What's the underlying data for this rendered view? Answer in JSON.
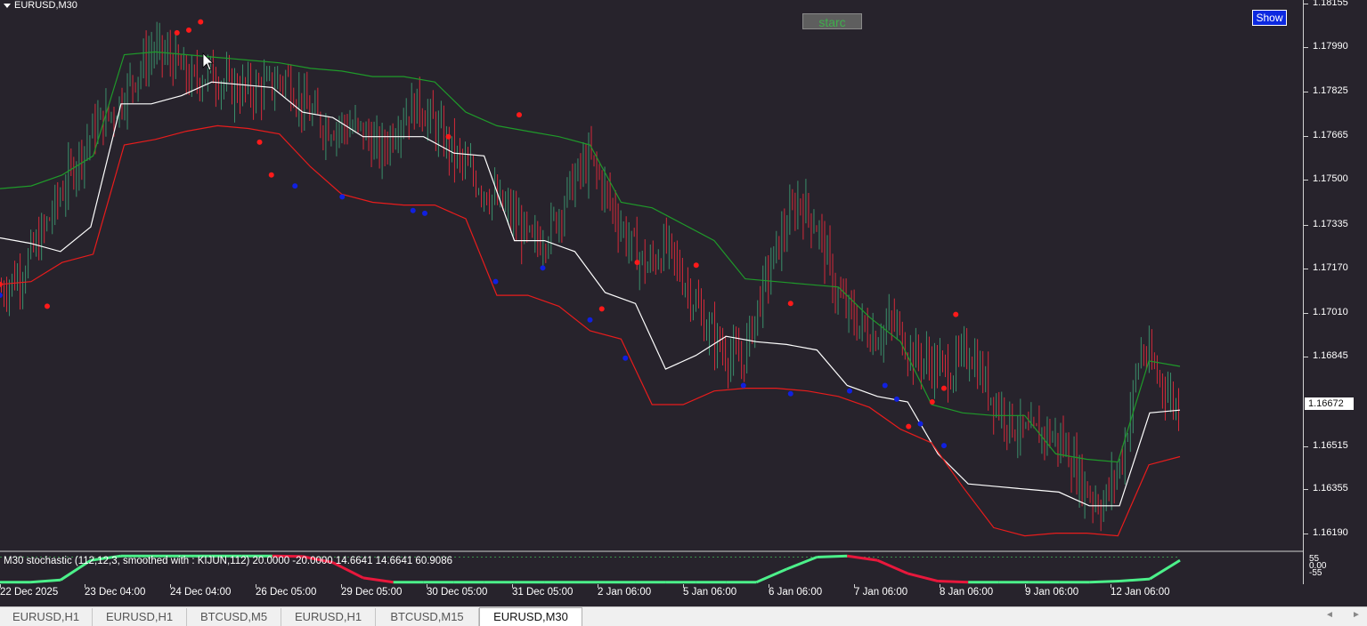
{
  "window": {
    "symbol_title": "EURUSD,M30"
  },
  "buttons": {
    "starc": "starc",
    "show": "Show"
  },
  "indicator": {
    "label": "M30 stochastic (112,12,3, smoothed with : KIJUN,112) 20.0000 -20.0000 14.6641 14.6641 60.9086"
  },
  "price_axis": {
    "labels": [
      "1.18155",
      "1.17990",
      "1.17825",
      "1.17665",
      "1.17500",
      "1.17335",
      "1.17170",
      "1.17010",
      "1.16845",
      "1.16515",
      "1.16355",
      "1.16190"
    ],
    "current_price": "1.16672"
  },
  "sub_axis": {
    "labels": [
      "55",
      "0.00",
      "-55"
    ]
  },
  "time_axis": {
    "labels": [
      "22 Dec 2025",
      "23 Dec 04:00",
      "24 Dec 04:00",
      "26 Dec 05:00",
      "29 Dec 05:00",
      "30 Dec 05:00",
      "31 Dec 05:00",
      "2 Jan 06:00",
      "5 Jan 06:00",
      "6 Jan 06:00",
      "7 Jan 06:00",
      "8 Jan 06:00",
      "9 Jan 06:00",
      "12 Jan 06:00"
    ]
  },
  "tabs": [
    {
      "label": "EURUSD,H1",
      "active": false
    },
    {
      "label": "EURUSD,H1",
      "active": false
    },
    {
      "label": "BTCUSD,M5",
      "active": false
    },
    {
      "label": "EURUSD,H1",
      "active": false
    },
    {
      "label": "BTCUSD,M15",
      "active": false
    },
    {
      "label": "EURUSD,M30",
      "active": true
    }
  ],
  "colors": {
    "background": "#27232c",
    "bull_candle": "#3a8f6b",
    "bear_candle": "#d42a3a",
    "upper_band": "#1f9a2a",
    "middle_line": "#ffffff",
    "lower_band": "#e81c1c",
    "signal_up": "#ff1a1a",
    "signal_down": "#1020e0",
    "stochastic_up": "#4cf08a",
    "stochastic_down": "#e8183c"
  },
  "chart_data": {
    "type": "line",
    "symbol": "EURUSD",
    "timeframe": "M30",
    "ylim": [
      1.1617,
      1.1818
    ],
    "x_ticks": [
      "22 Dec 2025",
      "23 Dec 04:00",
      "24 Dec 04:00",
      "26 Dec 05:00",
      "29 Dec 05:00",
      "30 Dec 05:00",
      "31 Dec 05:00",
      "2 Jan 06:00",
      "5 Jan 06:00",
      "6 Jan 06:00",
      "7 Jan 06:00",
      "8 Jan 06:00",
      "9 Jan 06:00",
      "12 Jan 06:00"
    ],
    "price_path": [
      1.1712,
      1.1718,
      1.173,
      1.1745,
      1.176,
      1.1772,
      1.1778,
      1.179,
      1.18,
      1.1796,
      1.1788,
      1.1792,
      1.1786,
      1.1785,
      1.1786,
      1.179,
      1.1778,
      1.1772,
      1.1772,
      1.177,
      1.1762,
      1.1775,
      1.178,
      1.177,
      1.176,
      1.1752,
      1.1745,
      1.1738,
      1.1728,
      1.1735,
      1.175,
      1.176,
      1.1745,
      1.173,
      1.172,
      1.1728,
      1.1715,
      1.17,
      1.169,
      1.1685,
      1.171,
      1.173,
      1.1745,
      1.1735,
      1.171,
      1.17,
      1.1695,
      1.17,
      1.1688,
      1.1685,
      1.1682,
      1.169,
      1.1675,
      1.1665,
      1.1658,
      1.166,
      1.1655,
      1.164,
      1.1633,
      1.165,
      1.169,
      1.168,
      1.1668
    ],
    "middle_line": [
      1.1731,
      1.1729,
      1.1726,
      1.1735,
      1.178,
      1.178,
      1.1783,
      1.1788,
      1.1787,
      1.1786,
      1.1777,
      1.1775,
      1.1768,
      1.1768,
      1.1768,
      1.1762,
      1.1761,
      1.173,
      1.173,
      1.1726,
      1.1711,
      1.1707,
      1.1683,
      1.1688,
      1.1695,
      1.1693,
      1.1692,
      1.169,
      1.1677,
      1.1673,
      1.1671,
      1.1652,
      1.1641,
      1.164,
      1.1639,
      1.1638,
      1.1633,
      1.1633,
      1.1667,
      1.1668
    ],
    "upper_band": [
      1.1749,
      1.175,
      1.1754,
      1.1761,
      1.1798,
      1.1799,
      1.1798,
      1.1797,
      1.1796,
      1.1795,
      1.1793,
      1.1792,
      1.179,
      1.179,
      1.1788,
      1.1777,
      1.1772,
      1.177,
      1.1768,
      1.1765,
      1.1744,
      1.1742,
      1.1736,
      1.173,
      1.1716,
      1.1715,
      1.1714,
      1.1713,
      1.1702,
      1.1693,
      1.167,
      1.1667,
      1.1666,
      1.1666,
      1.1652,
      1.165,
      1.1649,
      1.1686,
      1.1684
    ],
    "lower_band": [
      1.1714,
      1.1715,
      1.1722,
      1.1725,
      1.1765,
      1.1767,
      1.177,
      1.1772,
      1.1771,
      1.1769,
      1.1757,
      1.1747,
      1.1744,
      1.1743,
      1.1743,
      1.1738,
      1.171,
      1.171,
      1.1706,
      1.1697,
      1.1694,
      1.167,
      1.167,
      1.1675,
      1.1676,
      1.1676,
      1.1675,
      1.1673,
      1.1669,
      1.1661,
      1.1656,
      1.164,
      1.1625,
      1.1622,
      1.1623,
      1.1623,
      1.1622,
      1.1648,
      1.1651
    ],
    "signals_up": [
      [
        0.0,
        1.1714
      ],
      [
        0.04,
        1.1706
      ],
      [
        0.15,
        1.1806
      ],
      [
        0.16,
        1.1807
      ],
      [
        0.17,
        1.181
      ],
      [
        0.22,
        1.1766
      ],
      [
        0.23,
        1.1754
      ],
      [
        0.38,
        1.1768
      ],
      [
        0.44,
        1.1776
      ],
      [
        0.51,
        1.1705
      ],
      [
        0.54,
        1.1722
      ],
      [
        0.59,
        1.1721
      ],
      [
        0.67,
        1.1707
      ],
      [
        0.77,
        1.1662
      ],
      [
        0.79,
        1.1671
      ],
      [
        0.8,
        1.1676
      ],
      [
        0.81,
        1.1703
      ]
    ],
    "signals_down": [
      [
        0.0,
        1.171
      ],
      [
        0.25,
        1.175
      ],
      [
        0.29,
        1.1746
      ],
      [
        0.35,
        1.1741
      ],
      [
        0.36,
        1.174
      ],
      [
        0.42,
        1.1715
      ],
      [
        0.46,
        1.172
      ],
      [
        0.5,
        1.1701
      ],
      [
        0.53,
        1.1687
      ],
      [
        0.63,
        1.1677
      ],
      [
        0.67,
        1.1674
      ],
      [
        0.72,
        1.1675
      ],
      [
        0.75,
        1.1677
      ],
      [
        0.76,
        1.1672
      ],
      [
        0.78,
        1.1663
      ],
      [
        0.8,
        1.1655
      ]
    ],
    "stochastic": {
      "levels": [
        55,
        0.0,
        -55
      ],
      "series": [
        -60,
        -60,
        -50,
        40,
        60,
        60,
        60,
        60,
        60,
        60,
        58,
        30,
        -40,
        -60,
        -60,
        -60,
        -60,
        -60,
        -60,
        -60,
        -60,
        -60,
        -60,
        -60,
        -60,
        -60,
        0,
        55,
        60,
        40,
        -20,
        -55,
        -60,
        -60,
        -60,
        -60,
        -60,
        -55,
        -45,
        40
      ]
    }
  }
}
